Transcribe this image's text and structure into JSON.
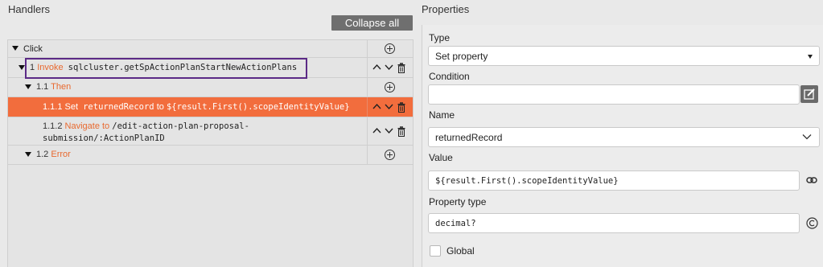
{
  "handlers": {
    "title": "Handlers",
    "collapse_label": "Collapse all",
    "tree": {
      "click": "Click",
      "invoke": {
        "num": "1",
        "keyword": "Invoke",
        "value": "sqlcluster.getSpActionPlanStartNewActionPlans"
      },
      "then": {
        "num": "1.1",
        "keyword": "Then"
      },
      "set": {
        "num": "1.1.1",
        "keyword": "Set",
        "name": "returnedRecord",
        "to": "to",
        "expr": "${result.First().scopeIdentityValue}"
      },
      "navigate": {
        "num": "1.1.2",
        "keyword": "Navigate to",
        "line1": "/edit-action-plan-proposal-",
        "line2": "submission/:ActionPlanID"
      },
      "error": {
        "num": "1.2",
        "keyword": "Error"
      }
    }
  },
  "properties": {
    "title": "Properties",
    "type": {
      "label": "Type",
      "value": "Set property"
    },
    "condition": {
      "label": "Condition",
      "value": ""
    },
    "name": {
      "label": "Name",
      "value": "returnedRecord"
    },
    "value": {
      "label": "Value",
      "value": "${result.First().scopeIdentityValue}"
    },
    "property_type": {
      "label": "Property type",
      "value": "decimal?"
    },
    "global": {
      "label": "Global",
      "checked": false
    }
  },
  "colors": {
    "accent": "#f26d3d",
    "keyword": "#e8692f",
    "highlight_border": "#5b2a86",
    "button": "#6f6f6f"
  }
}
